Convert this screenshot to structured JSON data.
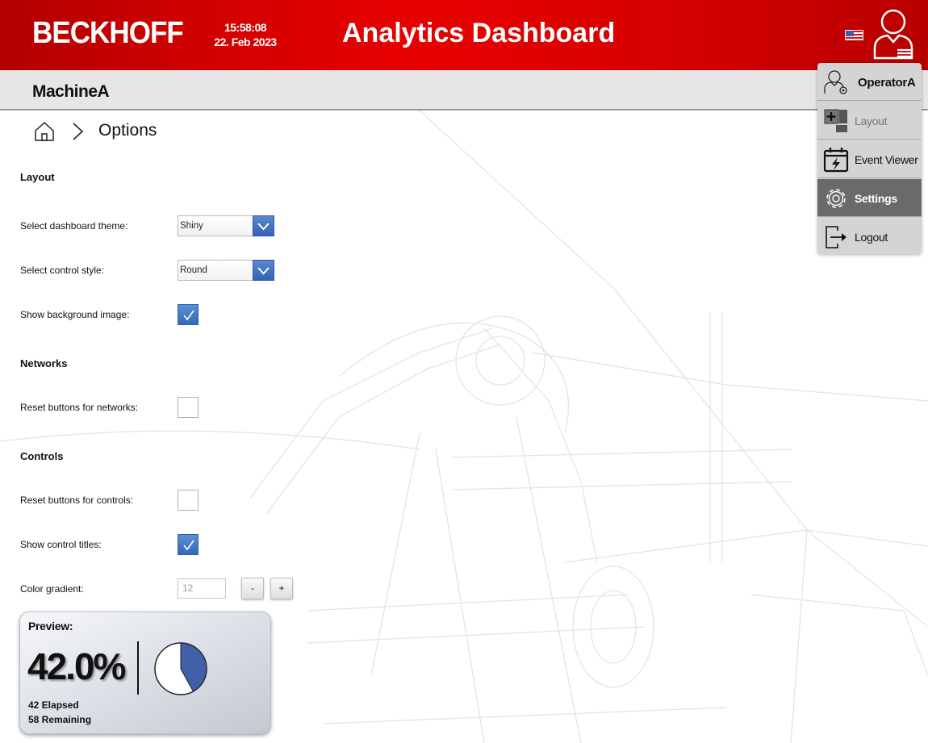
{
  "header": {
    "logo": "BECKHOFF",
    "time": "15:58:08",
    "date": "22. Feb 2023",
    "title": "Analytics Dashboard"
  },
  "subheader": {
    "machine": "MachineA"
  },
  "breadcrumb": {
    "current": "Options"
  },
  "layout_section": {
    "title": "Layout",
    "theme_label": "Select dashboard theme:",
    "theme_value": "Shiny",
    "style_label": "Select control style:",
    "style_value": "Round",
    "bg_label": "Show background image:",
    "bg_checked": true
  },
  "networks_section": {
    "title": "Networks",
    "reset_label": "Reset buttons for networks:",
    "reset_checked": false
  },
  "controls_section": {
    "title": "Controls",
    "reset_label": "Reset buttons for controls:",
    "reset_checked": false,
    "titles_label": "Show control titles:",
    "titles_checked": true,
    "gradient_label": "Color gradient:",
    "gradient_value": "12",
    "minus_label": "-",
    "plus_label": "+"
  },
  "preview": {
    "title": "Preview:",
    "percent_text": "42.0%",
    "percent": 42,
    "elapsed": "42 Elapsed",
    "remaining": "58 Remaining"
  },
  "user_menu": {
    "user": "OperatorA",
    "items": [
      {
        "label": "Layout",
        "icon": "layout-icon",
        "state": "disabled"
      },
      {
        "label": "Event Viewer",
        "icon": "event-viewer-icon",
        "state": "normal"
      },
      {
        "label": "Settings",
        "icon": "gear-icon",
        "state": "active"
      },
      {
        "label": "Logout",
        "icon": "logout-icon",
        "state": "normal"
      }
    ]
  },
  "colors": {
    "brand_red": "#d40000",
    "accent_blue": "#3468b8",
    "menu_active": "#6a6a6a",
    "pie_fill": "#3f5fa8"
  }
}
